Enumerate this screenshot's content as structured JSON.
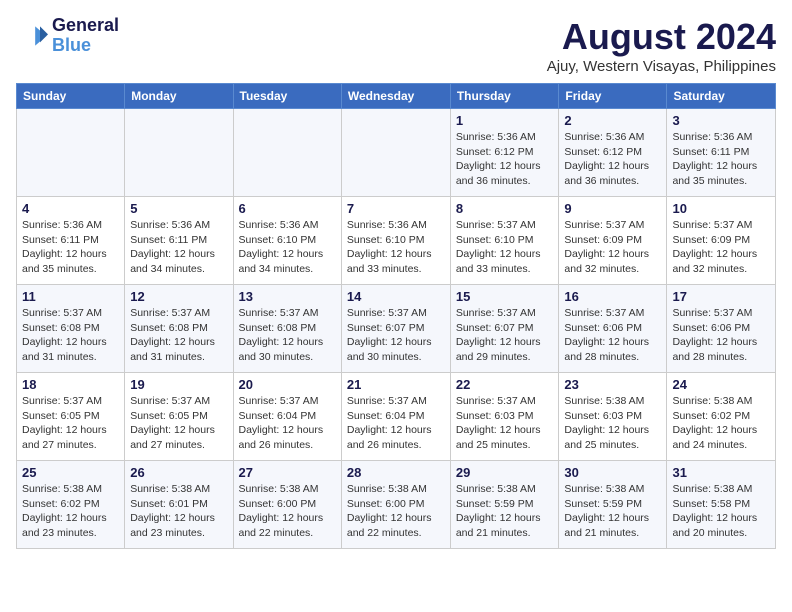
{
  "header": {
    "logo_line1": "General",
    "logo_line2": "Blue",
    "month_year": "August 2024",
    "location": "Ajuy, Western Visayas, Philippines"
  },
  "weekdays": [
    "Sunday",
    "Monday",
    "Tuesday",
    "Wednesday",
    "Thursday",
    "Friday",
    "Saturday"
  ],
  "weeks": [
    [
      {
        "day": "",
        "info": ""
      },
      {
        "day": "",
        "info": ""
      },
      {
        "day": "",
        "info": ""
      },
      {
        "day": "",
        "info": ""
      },
      {
        "day": "1",
        "info": "Sunrise: 5:36 AM\nSunset: 6:12 PM\nDaylight: 12 hours\nand 36 minutes."
      },
      {
        "day": "2",
        "info": "Sunrise: 5:36 AM\nSunset: 6:12 PM\nDaylight: 12 hours\nand 36 minutes."
      },
      {
        "day": "3",
        "info": "Sunrise: 5:36 AM\nSunset: 6:11 PM\nDaylight: 12 hours\nand 35 minutes."
      }
    ],
    [
      {
        "day": "4",
        "info": "Sunrise: 5:36 AM\nSunset: 6:11 PM\nDaylight: 12 hours\nand 35 minutes."
      },
      {
        "day": "5",
        "info": "Sunrise: 5:36 AM\nSunset: 6:11 PM\nDaylight: 12 hours\nand 34 minutes."
      },
      {
        "day": "6",
        "info": "Sunrise: 5:36 AM\nSunset: 6:10 PM\nDaylight: 12 hours\nand 34 minutes."
      },
      {
        "day": "7",
        "info": "Sunrise: 5:36 AM\nSunset: 6:10 PM\nDaylight: 12 hours\nand 33 minutes."
      },
      {
        "day": "8",
        "info": "Sunrise: 5:37 AM\nSunset: 6:10 PM\nDaylight: 12 hours\nand 33 minutes."
      },
      {
        "day": "9",
        "info": "Sunrise: 5:37 AM\nSunset: 6:09 PM\nDaylight: 12 hours\nand 32 minutes."
      },
      {
        "day": "10",
        "info": "Sunrise: 5:37 AM\nSunset: 6:09 PM\nDaylight: 12 hours\nand 32 minutes."
      }
    ],
    [
      {
        "day": "11",
        "info": "Sunrise: 5:37 AM\nSunset: 6:08 PM\nDaylight: 12 hours\nand 31 minutes."
      },
      {
        "day": "12",
        "info": "Sunrise: 5:37 AM\nSunset: 6:08 PM\nDaylight: 12 hours\nand 31 minutes."
      },
      {
        "day": "13",
        "info": "Sunrise: 5:37 AM\nSunset: 6:08 PM\nDaylight: 12 hours\nand 30 minutes."
      },
      {
        "day": "14",
        "info": "Sunrise: 5:37 AM\nSunset: 6:07 PM\nDaylight: 12 hours\nand 30 minutes."
      },
      {
        "day": "15",
        "info": "Sunrise: 5:37 AM\nSunset: 6:07 PM\nDaylight: 12 hours\nand 29 minutes."
      },
      {
        "day": "16",
        "info": "Sunrise: 5:37 AM\nSunset: 6:06 PM\nDaylight: 12 hours\nand 28 minutes."
      },
      {
        "day": "17",
        "info": "Sunrise: 5:37 AM\nSunset: 6:06 PM\nDaylight: 12 hours\nand 28 minutes."
      }
    ],
    [
      {
        "day": "18",
        "info": "Sunrise: 5:37 AM\nSunset: 6:05 PM\nDaylight: 12 hours\nand 27 minutes."
      },
      {
        "day": "19",
        "info": "Sunrise: 5:37 AM\nSunset: 6:05 PM\nDaylight: 12 hours\nand 27 minutes."
      },
      {
        "day": "20",
        "info": "Sunrise: 5:37 AM\nSunset: 6:04 PM\nDaylight: 12 hours\nand 26 minutes."
      },
      {
        "day": "21",
        "info": "Sunrise: 5:37 AM\nSunset: 6:04 PM\nDaylight: 12 hours\nand 26 minutes."
      },
      {
        "day": "22",
        "info": "Sunrise: 5:37 AM\nSunset: 6:03 PM\nDaylight: 12 hours\nand 25 minutes."
      },
      {
        "day": "23",
        "info": "Sunrise: 5:38 AM\nSunset: 6:03 PM\nDaylight: 12 hours\nand 25 minutes."
      },
      {
        "day": "24",
        "info": "Sunrise: 5:38 AM\nSunset: 6:02 PM\nDaylight: 12 hours\nand 24 minutes."
      }
    ],
    [
      {
        "day": "25",
        "info": "Sunrise: 5:38 AM\nSunset: 6:02 PM\nDaylight: 12 hours\nand 23 minutes."
      },
      {
        "day": "26",
        "info": "Sunrise: 5:38 AM\nSunset: 6:01 PM\nDaylight: 12 hours\nand 23 minutes."
      },
      {
        "day": "27",
        "info": "Sunrise: 5:38 AM\nSunset: 6:00 PM\nDaylight: 12 hours\nand 22 minutes."
      },
      {
        "day": "28",
        "info": "Sunrise: 5:38 AM\nSunset: 6:00 PM\nDaylight: 12 hours\nand 22 minutes."
      },
      {
        "day": "29",
        "info": "Sunrise: 5:38 AM\nSunset: 5:59 PM\nDaylight: 12 hours\nand 21 minutes."
      },
      {
        "day": "30",
        "info": "Sunrise: 5:38 AM\nSunset: 5:59 PM\nDaylight: 12 hours\nand 21 minutes."
      },
      {
        "day": "31",
        "info": "Sunrise: 5:38 AM\nSunset: 5:58 PM\nDaylight: 12 hours\nand 20 minutes."
      }
    ]
  ]
}
